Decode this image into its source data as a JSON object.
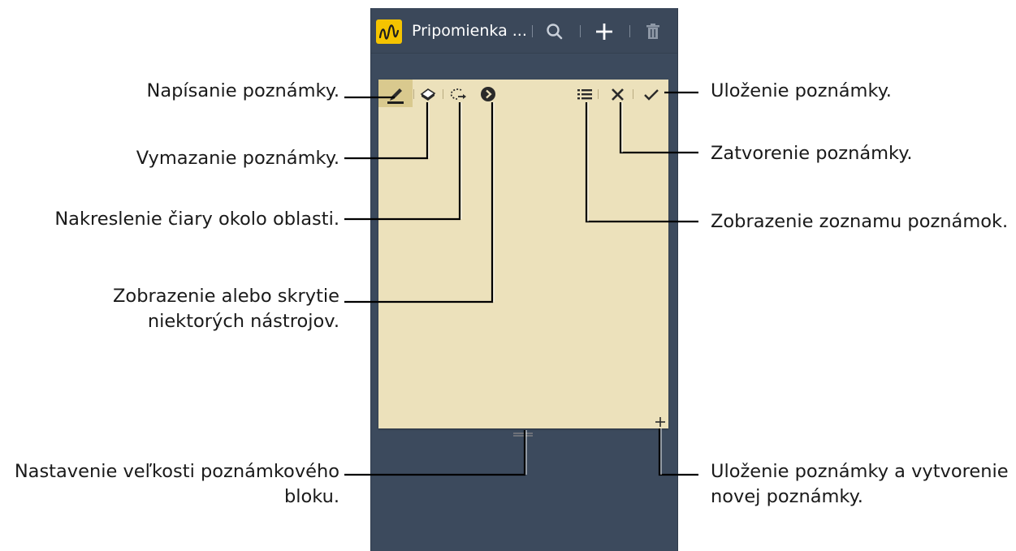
{
  "app": {
    "title": "Pripomienka ...",
    "icon": "pen-scribble-icon",
    "actions": [
      "search-icon",
      "plus-icon",
      "trash-icon"
    ]
  },
  "pad": {
    "tools": [
      "pen-icon",
      "eraser-icon",
      "lasso-icon",
      "expand-arrow-icon"
    ],
    "right_tools": [
      "list-icon",
      "close-icon",
      "checkmark-icon"
    ],
    "color": "#ece1bb"
  },
  "labels": {
    "write": "Napísanie poznámky.",
    "erase": "Vymazanie poznámky.",
    "lasso": "Nakreslenie čiary okolo oblasti.",
    "toggle_tools_1": "Zobrazenie alebo skrytie",
    "toggle_tools_2": "niektorých nástrojov.",
    "resize_1": "Nastavenie veľkosti poznámkového",
    "resize_2": "bloku.",
    "save": "Uloženie poznámky.",
    "close": "Zatvorenie poznámky.",
    "list": "Zobrazenie zoznamu poznámok.",
    "save_new_1": "Uloženie poznámky a vytvorenie",
    "save_new_2": "novej poznámky."
  },
  "colors": {
    "screen_bg": "#3c4a5d",
    "pad_bg": "#ece1bb",
    "callout_line": "#000000"
  }
}
